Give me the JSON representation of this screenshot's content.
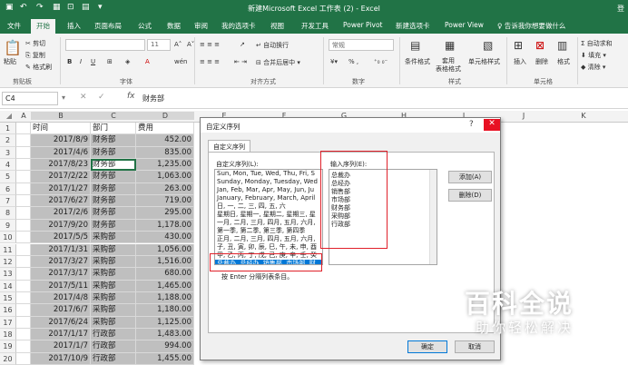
{
  "window": {
    "title": "新建Microsoft Excel 工作表 (2) - Excel",
    "login": "登"
  },
  "tabs": [
    {
      "label": "文件"
    },
    {
      "label": "开始"
    },
    {
      "label": "插入"
    },
    {
      "label": "页面布局"
    },
    {
      "label": "公式"
    },
    {
      "label": "数据"
    },
    {
      "label": "审阅"
    },
    {
      "label": "我的选项卡"
    },
    {
      "label": "视图"
    },
    {
      "label": "开发工具"
    },
    {
      "label": "Power Pivot"
    },
    {
      "label": "新建选项卡"
    },
    {
      "label": "Power View"
    },
    {
      "label": "♀ 告诉我你想要做什么"
    }
  ],
  "ribbon": {
    "paste": "粘贴",
    "cut": "剪切",
    "copy": "复制",
    "format_painter": "格式刷",
    "clipboard": "剪贴板",
    "font_size": "11",
    "font_group": "字体",
    "wrap": "自动换行",
    "merge": "合并后居中",
    "align_group": "对齐方式",
    "num_format": "常规",
    "percent": "% ,",
    "number_group": "数字",
    "cond_format": "条件格式",
    "table_format": "套用\n表格格式",
    "cell_style": "单元格样式",
    "style_group": "样式",
    "insert": "插入",
    "delete": "删除",
    "format": "格式",
    "cells_group": "单元格",
    "autosum": "自动求和",
    "fill": "填充",
    "clear": "清除"
  },
  "formula_bar": {
    "name_box": "C4",
    "value": "财务部"
  },
  "columns": [
    "A",
    "B",
    "C",
    "D",
    "E",
    "F",
    "G",
    "H",
    "I",
    "J",
    "K"
  ],
  "headers": {
    "b": "时间",
    "c": "部门",
    "d": "费用"
  },
  "rows": [
    {
      "n": "1"
    },
    {
      "n": "2",
      "date": "2017/8/9",
      "dept": "财务部",
      "cost": "452.00"
    },
    {
      "n": "3",
      "date": "2017/4/6",
      "dept": "财务部",
      "cost": "835.00"
    },
    {
      "n": "4",
      "date": "2017/8/23",
      "dept": "财务部",
      "cost": "1,235.00"
    },
    {
      "n": "5",
      "date": "2017/2/22",
      "dept": "财务部",
      "cost": "1,063.00"
    },
    {
      "n": "6",
      "date": "2017/1/27",
      "dept": "财务部",
      "cost": "263.00"
    },
    {
      "n": "7",
      "date": "2017/6/27",
      "dept": "财务部",
      "cost": "719.00"
    },
    {
      "n": "8",
      "date": "2017/2/6",
      "dept": "财务部",
      "cost": "295.00"
    },
    {
      "n": "9",
      "date": "2017/9/20",
      "dept": "财务部",
      "cost": "1,178.00"
    },
    {
      "n": "10",
      "date": "2017/5/5",
      "dept": "采购部",
      "cost": "430.00"
    },
    {
      "n": "11",
      "date": "2017/1/31",
      "dept": "采购部",
      "cost": "1,056.00"
    },
    {
      "n": "12",
      "date": "2017/3/27",
      "dept": "采购部",
      "cost": "1,516.00"
    },
    {
      "n": "13",
      "date": "2017/3/17",
      "dept": "采购部",
      "cost": "680.00"
    },
    {
      "n": "14",
      "date": "2017/5/11",
      "dept": "采购部",
      "cost": "1,465.00"
    },
    {
      "n": "15",
      "date": "2017/4/8",
      "dept": "采购部",
      "cost": "1,188.00"
    },
    {
      "n": "16",
      "date": "2017/6/7",
      "dept": "采购部",
      "cost": "1,180.00"
    },
    {
      "n": "17",
      "date": "2017/6/24",
      "dept": "采购部",
      "cost": "1,125.00"
    },
    {
      "n": "18",
      "date": "2017/1/17",
      "dept": "行政部",
      "cost": "1,483.00"
    },
    {
      "n": "19",
      "date": "2017/1/7",
      "dept": "行政部",
      "cost": "994.00"
    },
    {
      "n": "20",
      "date": "2017/10/9",
      "dept": "行政部",
      "cost": "1,455.00"
    }
  ],
  "dialog": {
    "title": "自定义序列",
    "tab": "自定义序列",
    "lists_label": "自定义序列(L):",
    "entries_label": "输入序列(E):",
    "lists": [
      "Sun, Mon, Tue, Wed, Thu, Fri, S",
      "Sunday, Monday, Tuesday, Wed",
      "Jan, Feb, Mar, Apr, May, Jun, Ju",
      "January, February, March, April",
      "日, 一, 二, 三, 四, 五, 六",
      "星期日, 星期一, 星期二, 星期三, 星",
      "一月, 二月, 三月, 四月, 五月, 六月,",
      "第一季, 第二季, 第三季, 第四季",
      "正月, 二月, 三月, 四月, 五月, 六月,",
      "子, 丑, 寅, 卯, 辰, 巳, 午, 未, 申, 酉",
      "甲, 乙, 丙, 丁, 戊, 己, 庚, 辛, 壬, 癸",
      "总裁办, 总经办, 销售部, 市场部, 财"
    ],
    "entries": [
      "总裁办",
      "总经办",
      "销售部",
      "市场部",
      "财务部",
      "采购部",
      "行政部"
    ],
    "add": "添加(A)",
    "delete": "删除(D)",
    "hint": "按 Enter 分隔列表条目。",
    "ok": "确定",
    "cancel": "取消"
  },
  "watermark": {
    "main": "百科全说",
    "sub": "助你轻松解决"
  }
}
